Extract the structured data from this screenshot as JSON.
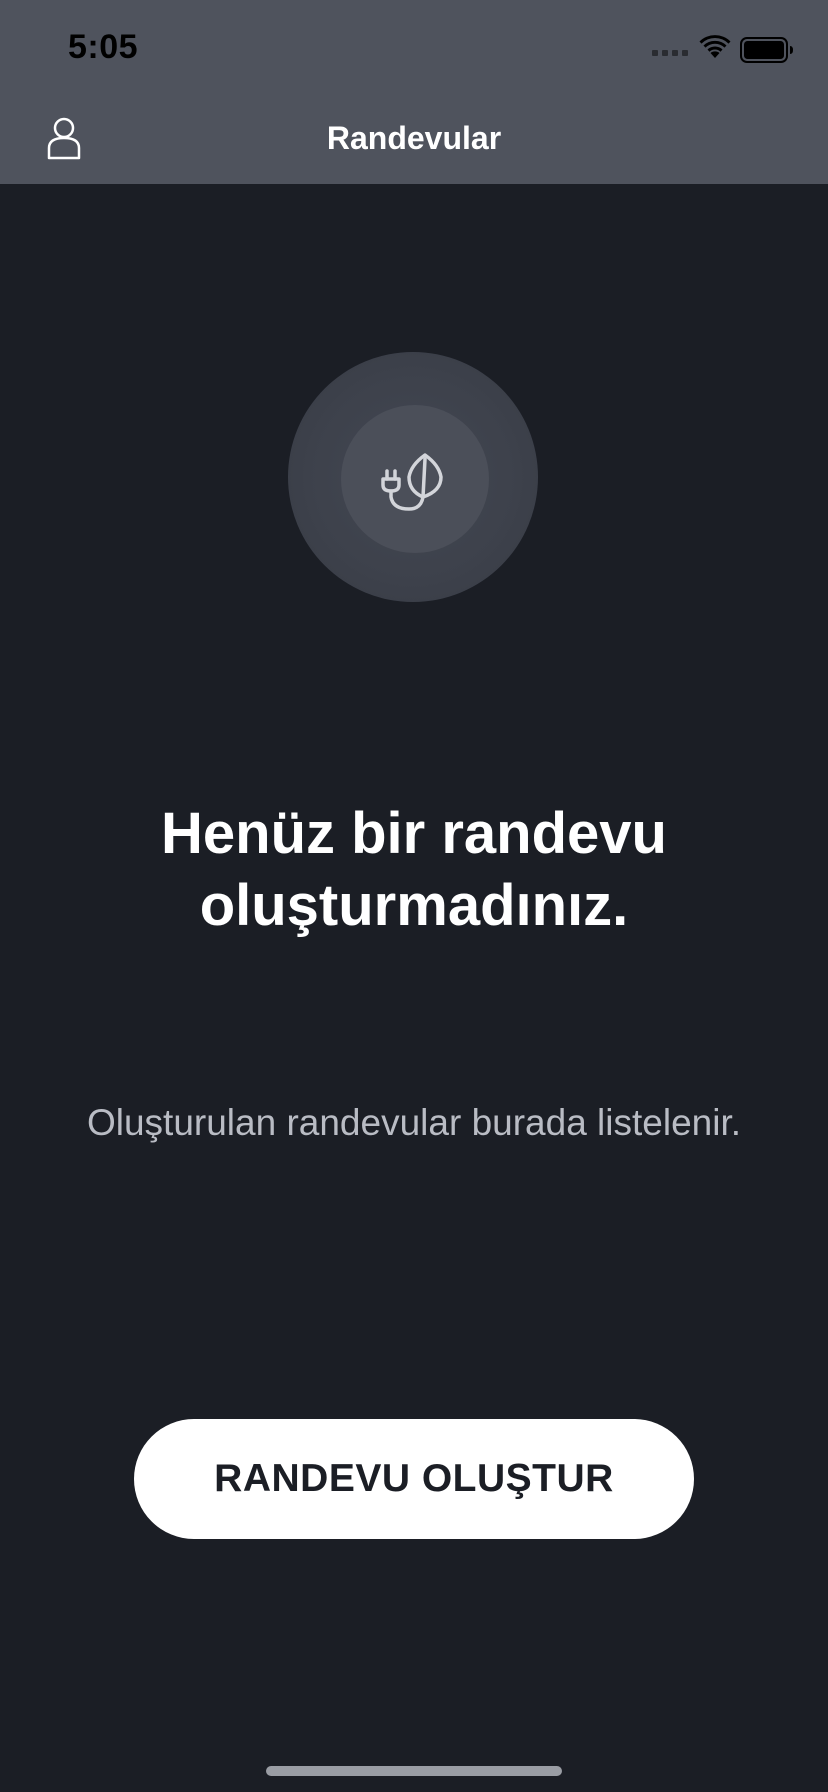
{
  "status_bar": {
    "time": "5:05",
    "icons": [
      "signal-icon",
      "wifi-icon",
      "battery-icon"
    ]
  },
  "nav": {
    "title": "Randevular",
    "profile_icon": "person-icon"
  },
  "hero": {
    "icon": "plug-leaf-icon"
  },
  "empty_state": {
    "title_line1": "Henüz bir randevu",
    "title_line2": "oluşturmadınız.",
    "subtitle": "Oluşturulan randevular burada listelenir."
  },
  "actions": {
    "create_label": "RANDEVU OLUŞTUR"
  },
  "colors": {
    "background": "#1b1e25",
    "header": "#4f535d",
    "button": "#ffffff",
    "button_text": "#1b1e25",
    "subtitle": "#b9bcc4"
  }
}
